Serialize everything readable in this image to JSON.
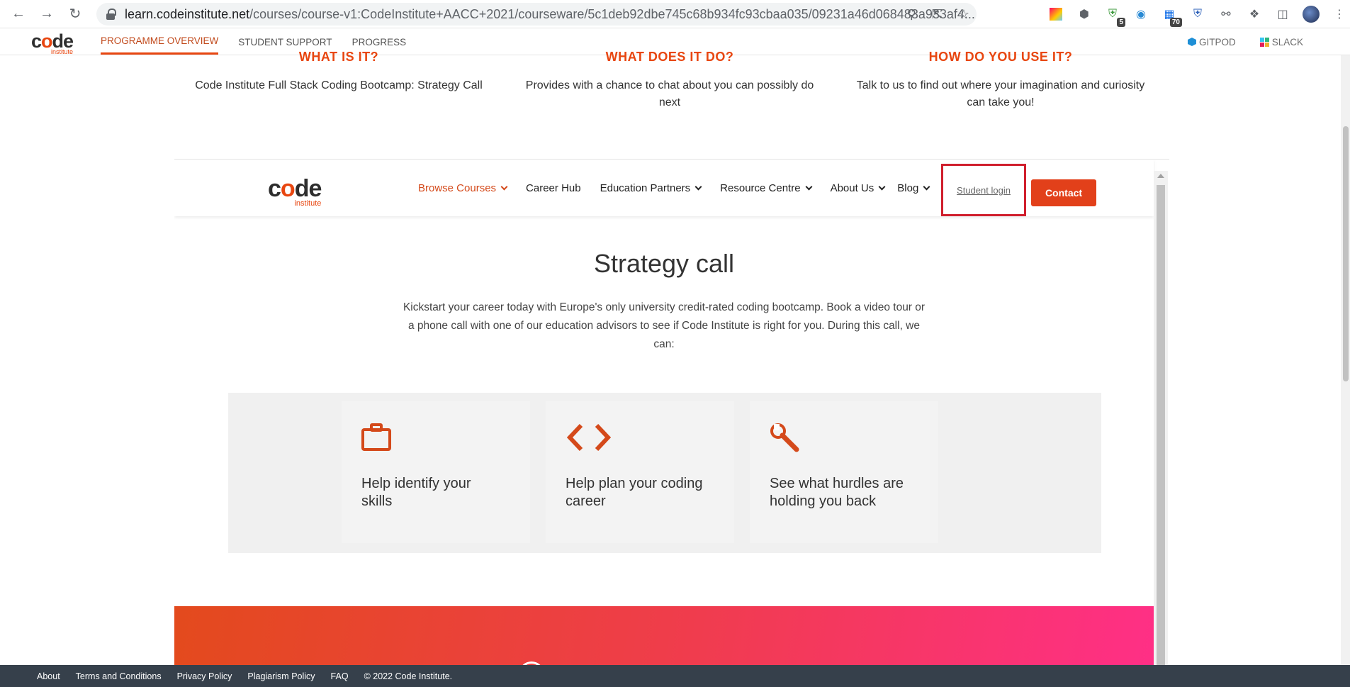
{
  "browser": {
    "url_host": "learn.codeinstitute.net",
    "url_path": "/courses/course-v1:CodeInstitute+AACC+2021/courseware/5c1deb92dbe745c68b934fc93cbaa035/09231a46d068483a933af4...",
    "ext_badge_1": "5",
    "ext_badge_2": "70"
  },
  "lms": {
    "logo_main": "c",
    "logo_o": "o",
    "logo_rest": "de",
    "logo_sub": "institute",
    "tabs": [
      "PROGRAMME OVERVIEW",
      "STUDENT SUPPORT",
      "PROGRESS"
    ],
    "gitpod": "GITPOD",
    "slack": "SLACK"
  },
  "columns": [
    {
      "head": "WHAT IS IT?",
      "text": "Code Institute Full Stack Coding Bootcamp: Strategy Call"
    },
    {
      "head": "WHAT DOES IT DO?",
      "text": "Provides with a chance to chat about you can possibly do next"
    },
    {
      "head": "HOW DO YOU USE IT?",
      "text": "Talk to us to find out where your imagination and curiosity can take you!"
    }
  ],
  "site_nav": {
    "menu": [
      "Browse Courses",
      "Career Hub",
      "Education Partners",
      "Resource Centre",
      "About Us",
      "Blog"
    ],
    "student_login": "Student login",
    "contact": "Contact"
  },
  "strategy": {
    "title": "Strategy call",
    "description": "Kickstart your career today with Europe's only university credit-rated coding bootcamp. Book a video tour or a phone call with one of our education advisors to see if Code Institute is right for you. During this call, we can:"
  },
  "cards": [
    {
      "icon": "briefcase-icon",
      "text": "Help identify your skills"
    },
    {
      "icon": "code-icon",
      "text": "Help plan your coding career"
    },
    {
      "icon": "wrench-icon",
      "text": "See what hurdles are holding you back"
    }
  ],
  "footer": [
    "About",
    "Terms and Conditions",
    "Privacy Policy",
    "Plagiarism Policy",
    "FAQ",
    "© 2022 Code Institute."
  ],
  "colors": {
    "accent": "#e84610",
    "contact": "#e2401a",
    "highlight": "#d01f2d",
    "footer": "#36404b"
  }
}
